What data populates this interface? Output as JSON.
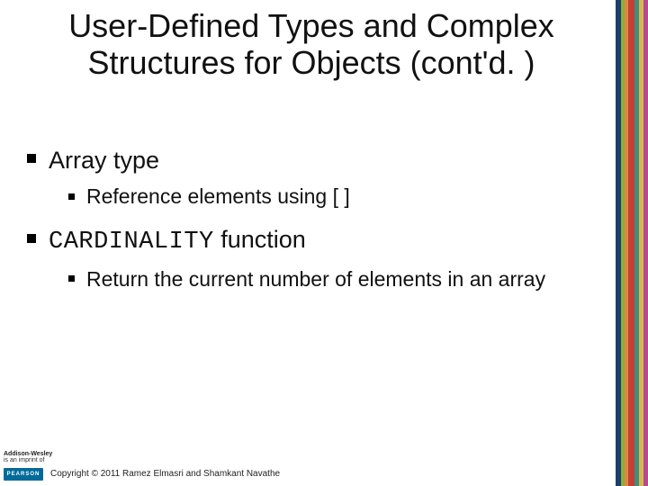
{
  "title": "User-Defined Types and Complex Structures for Objects (cont'd. )",
  "bullets": {
    "item1": {
      "label": "Array type",
      "sub1": "Reference elements using [ ]"
    },
    "item2": {
      "code": "CARDINALITY",
      "rest": " function",
      "sub1": "Return the current number of elements in an array"
    }
  },
  "footer": {
    "imprint_line1": "Addison-Wesley",
    "imprint_line2": "is an imprint of",
    "pearson": "PEARSON",
    "copyright": "Copyright © 2011 Ramez Elmasri and Shamkant Navathe"
  }
}
